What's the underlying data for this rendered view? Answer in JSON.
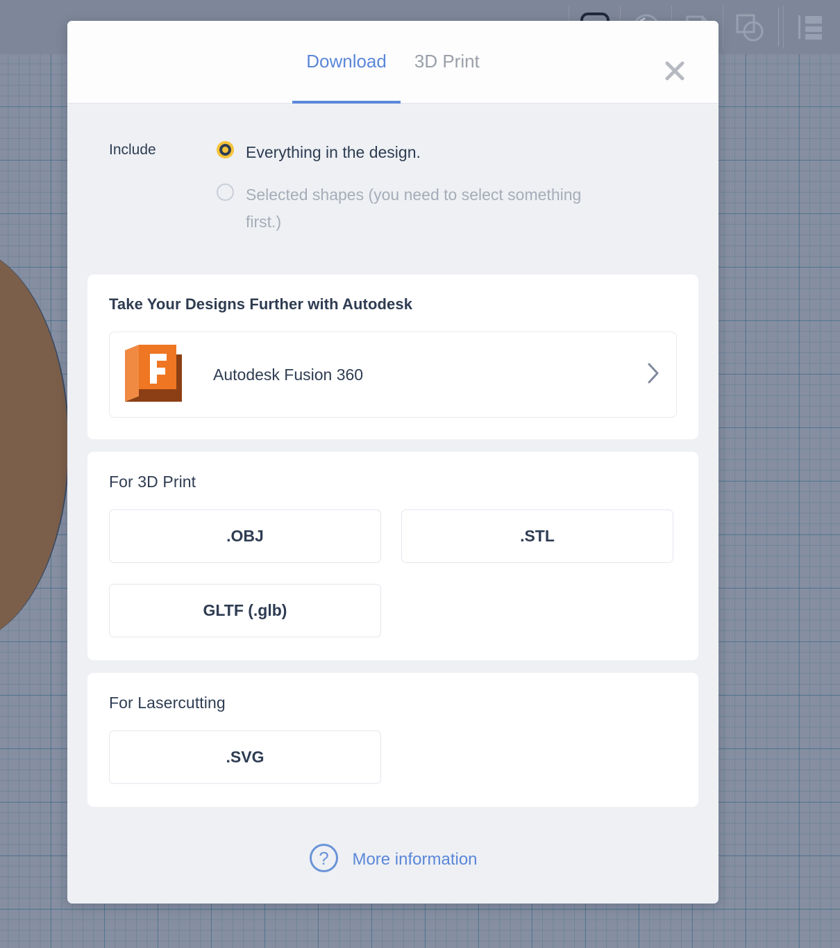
{
  "app": {
    "background": "tinkercad-workplane",
    "workplane_color": "#868fa1",
    "grid_line_color": "#2b5c82",
    "shape_color": "#7c5f4a",
    "toolbar_icons": [
      "snap-grid-icon",
      "circle-shape-icon",
      "note-icon",
      "shape-combine-icon",
      "panel-layout-icon"
    ]
  },
  "modal": {
    "tabs": [
      {
        "label": "Download",
        "active": true,
        "name": "tab-download"
      },
      {
        "label": "3D Print",
        "active": false,
        "name": "tab-3d-print"
      }
    ],
    "close_label": "×",
    "accent_color": "#5b87d8",
    "include": {
      "label": "Include",
      "options": [
        {
          "label": "Everything in the design.",
          "selected": true,
          "disabled": false
        },
        {
          "label": "Selected shapes (you need to select something first.)",
          "selected": false,
          "disabled": true
        }
      ],
      "selected_color": "#f5c33b"
    },
    "autodesk_card": {
      "title": "Take Your Designs Further with Autodesk",
      "product": {
        "name": "Autodesk Fusion 360",
        "icon": "fusion-360-icon",
        "icon_color": "#ef7622",
        "icon_shadow_color": "#8c3f14",
        "icon_letter": "F",
        "chevron": "chevron-right-icon"
      }
    },
    "print_card": {
      "title": "For 3D Print",
      "formats": [
        ".OBJ",
        ".STL",
        "GLTF (.glb)"
      ]
    },
    "laser_card": {
      "title": "For Lasercutting",
      "formats": [
        ".SVG"
      ]
    },
    "footer": {
      "icon": "question-circle-icon",
      "label": "More information",
      "color": "#5b87d8"
    }
  }
}
